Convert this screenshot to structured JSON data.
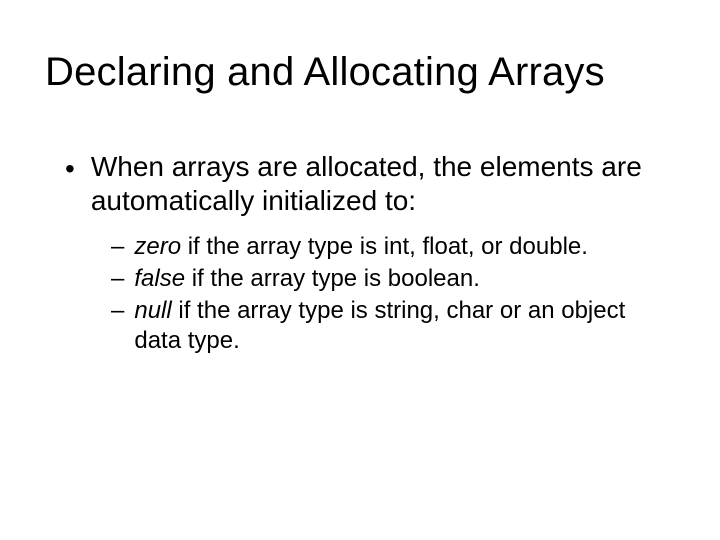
{
  "title": "Declaring and Allocating Arrays",
  "bullet1": "When arrays are allocated, the elements are automatically initialized to:",
  "sub1_keyword": "zero",
  "sub1_rest": " if the array type is int, float, or double.",
  "sub2_keyword": "false",
  "sub2_rest": " if the array type is boolean.",
  "sub3_keyword": "null",
  "sub3_rest": " if the array type is string, char or an object data type."
}
